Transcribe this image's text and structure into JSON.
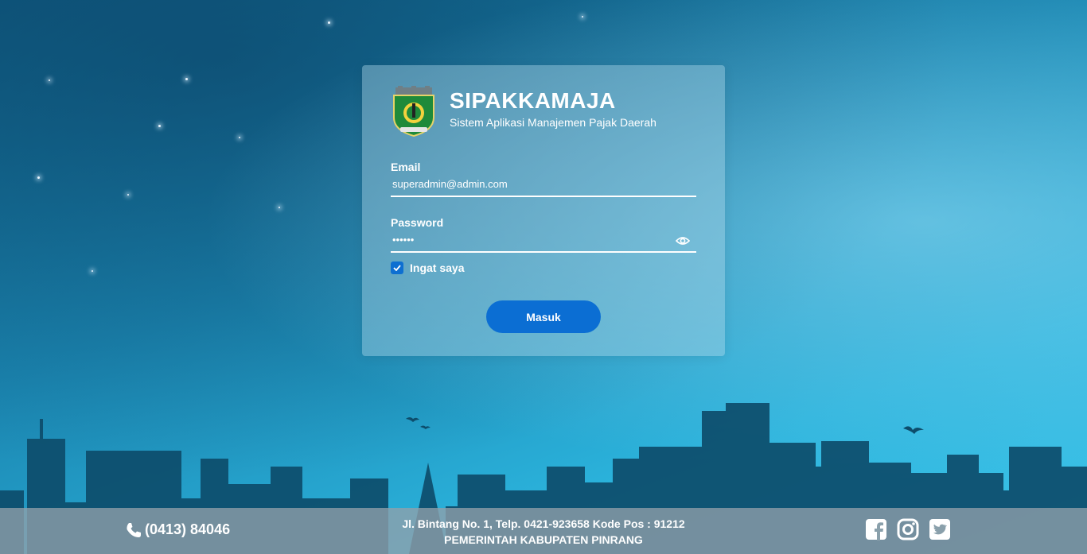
{
  "app": {
    "title": "SIPAKKAMAJA",
    "subtitle": "Sistem Aplikasi Manajemen Pajak Daerah"
  },
  "form": {
    "email_label": "Email",
    "email_value": "superadmin@admin.com",
    "password_label": "Password",
    "password_value": "••••••",
    "remember_label": "Ingat saya",
    "remember_checked": true,
    "submit_label": "Masuk"
  },
  "footer": {
    "phone": "(0413) 84046",
    "address": "Jl. Bintang No. 1, Telp. 0421-923658 Kode Pos : 91212",
    "government": "PEMERINTAH KABUPATEN PINRANG",
    "social_icons": [
      "facebook-icon",
      "instagram-icon",
      "twitter-icon"
    ]
  },
  "colors": {
    "primary_button": "#0b6ed3",
    "checkbox": "#0d6fd1",
    "sky_dark": "#0f5f86",
    "sky_light": "#3ec5ea",
    "skyline": "#0d4d6c"
  }
}
